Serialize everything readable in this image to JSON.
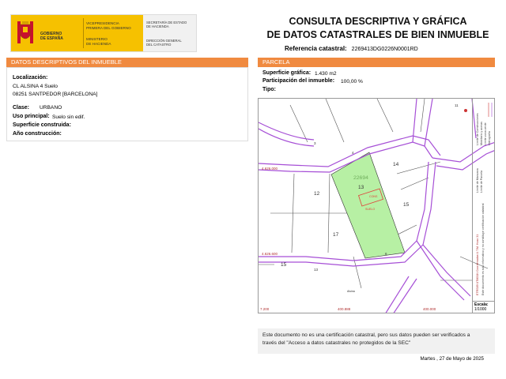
{
  "header": {
    "gov_line1": "GOBIERNO",
    "gov_line2": "DE ESPAÑA",
    "vice_line1": "VICEPRESIDENCIA",
    "vice_line2": "PRIMERA DEL GOBIERNO",
    "min_line1": "MINISTERIO",
    "min_line2": "DE HACIENDA",
    "sec_line1": "SECRETARÍA DE ESTADO",
    "sec_line2": "DE HACIENDA",
    "dir_line1": "DIRECCIÓN GENERAL",
    "dir_line2": "DEL CATASTRO",
    "title_line1": "CONSULTA DESCRIPTIVA Y GRÁFICA",
    "title_line2": "DE DATOS CATASTRALES DE BIEN INMUEBLE",
    "ref_label": "Referencia catastral:",
    "ref_value": "2269413DG0226N0001RD"
  },
  "left": {
    "section_title": "DATOS DESCRIPTIVOS DEL INMUEBLE",
    "localizacion_label": "Localización:",
    "localizacion_line1": "CL ALSINA 4 Suelo",
    "localizacion_line2": "08251 SANTPEDOR [BARCELONA]",
    "clase_label": "Clase:",
    "clase_value": "URBANO",
    "uso_label": "Uso principal:",
    "uso_value": "Suelo sin edif.",
    "superficie_label": "Superficie construida:",
    "anio_label": "Año construcción:"
  },
  "right": {
    "section_title": "PARCELA",
    "sup_grafica_label": "Superficie gráfica:",
    "sup_grafica_value": "1.430 m2",
    "participacion_label": "Participación del inmueble:",
    "participacion_value": "100,00 %",
    "tipo_label": "Tipo:"
  },
  "map": {
    "parcel_ref": "22694",
    "labels": {
      "n14": "14",
      "n13": "13",
      "n12": "12",
      "n15a": "15",
      "n17": "17",
      "n15b": "15",
      "n6": "6",
      "n4": "4",
      "n3": "3",
      "n11": "11",
      "n13b": "13",
      "c1": "CONS",
      "c2": "SUELO",
      "coord_y1": "4.626.000",
      "coord_y2": "4.626.600",
      "coord_x1": "400.888",
      "coord_x2": "400.000",
      "coord_x0": "7.200",
      "street1": "Alsina"
    },
    "side_texts": [
      "Límite de Manzana",
      "Límite de Parcela",
      "Límite de Construcciones",
      "Mobiliario y aceras",
      "Límite zona verde",
      "Hidrografía"
    ],
    "side_info": "ETRS89 UTM31N Coordenadas U.T.M. Huso 31",
    "side_info2": "Este documento es solo informativo y no constituye certificación catastral",
    "scale_label": "Escala:",
    "scale_value": "1/1000",
    "colors": {
      "parcel_fill": "#b7f0a4",
      "roads": "#a64fd6",
      "building": "#e0413a"
    }
  },
  "note": {
    "line1": "Este documento no es una certificación catastral, pero sus datos pueden ser verificados a",
    "line2": "través del \"Acceso a datos catastrales no protegidos de la SEC\""
  },
  "footer": {
    "date": "Martes , 27 de Mayo de 2025"
  }
}
